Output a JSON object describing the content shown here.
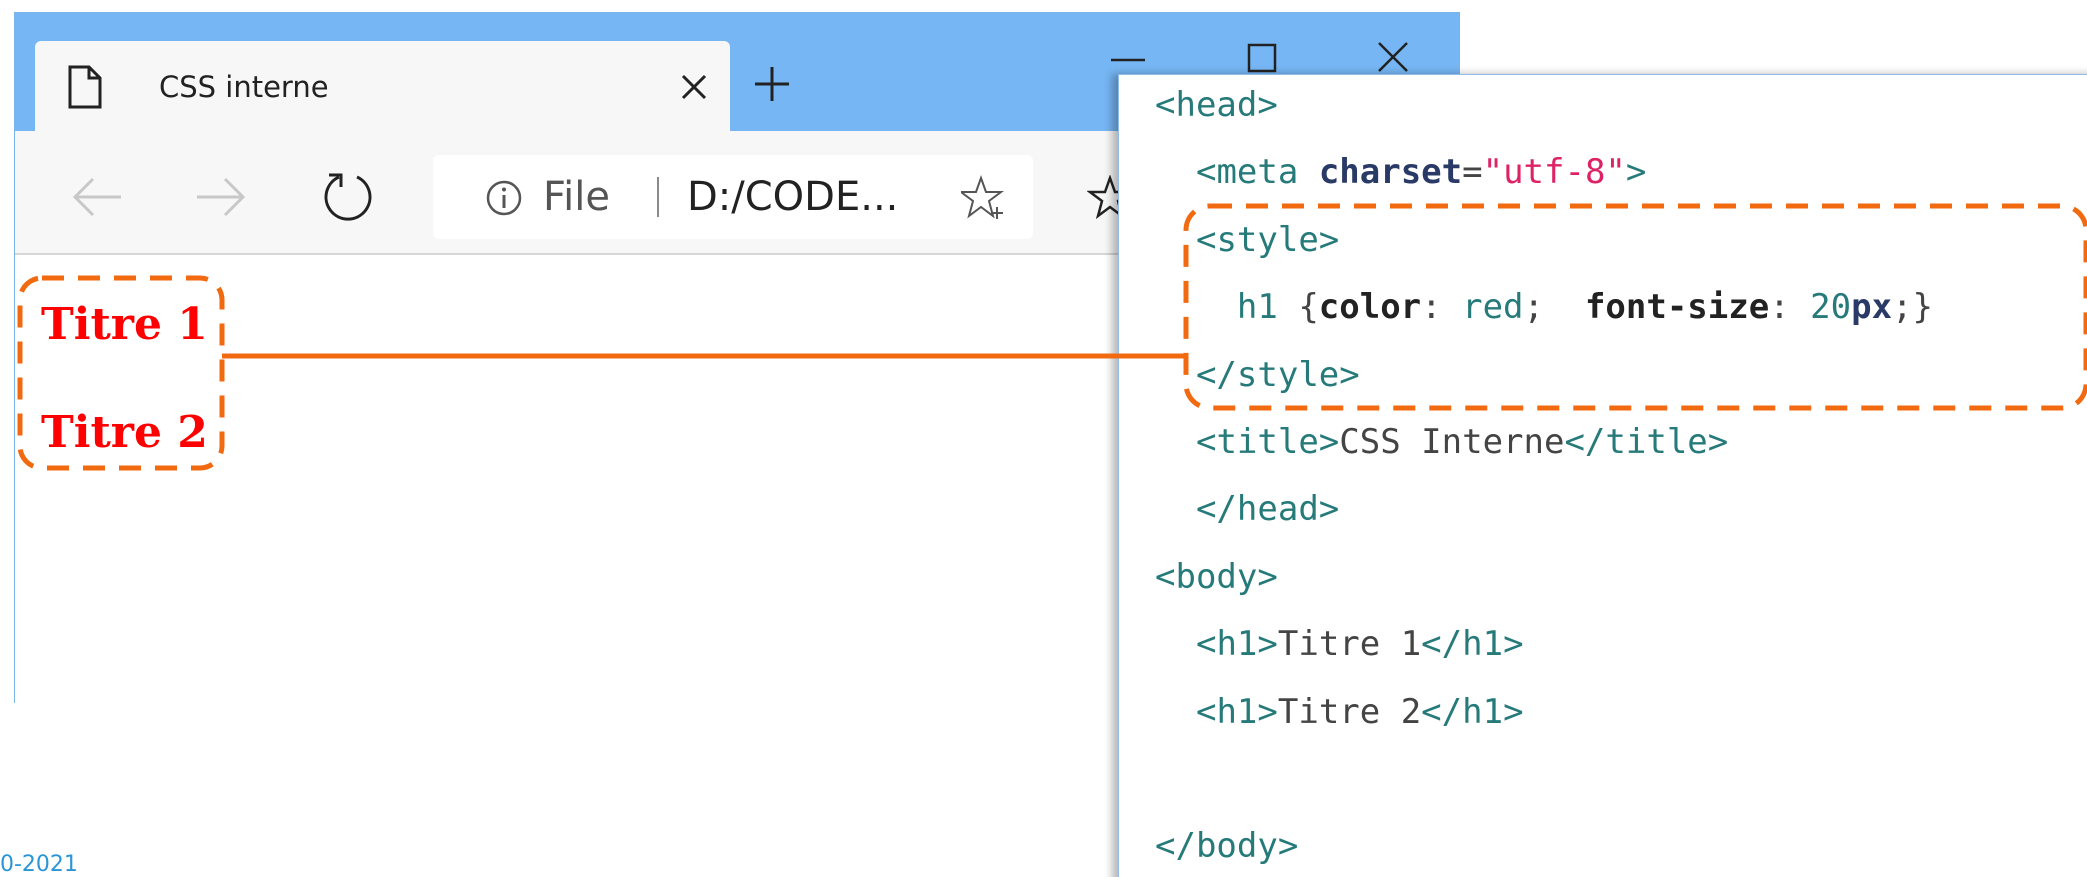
{
  "browser": {
    "tab": {
      "title": "CSS interne",
      "icon": "page-icon",
      "close_icon": "close-icon"
    },
    "new_tab_icon": "plus-icon",
    "window_controls": [
      "minimize-icon",
      "maximize-icon",
      "close-icon"
    ],
    "toolbar": {
      "back_icon": "arrow-left-icon",
      "forward_icon": "arrow-right-icon",
      "reload_icon": "reload-icon",
      "address": {
        "info_icon": "info-icon",
        "scheme_label": "File",
        "url": "D:/CODE...",
        "favorite_icon": "star-plus-icon"
      },
      "favorites_icon": "star-icon"
    },
    "page": {
      "headings": [
        "Titre 1",
        "Titre 2"
      ],
      "heading_color": "#ff0000"
    }
  },
  "code": {
    "lines": [
      [
        {
          "t": "<",
          "c": "tag"
        },
        {
          "t": "head",
          "c": "tag"
        },
        {
          "t": ">",
          "c": "tag"
        }
      ],
      [
        {
          "t": "  "
        },
        {
          "t": "<",
          "c": "tag"
        },
        {
          "t": "meta",
          "c": "tag"
        },
        {
          "t": " "
        },
        {
          "t": "charset",
          "c": "attr"
        },
        {
          "t": "="
        },
        {
          "t": "\"utf-8\"",
          "c": "str"
        },
        {
          "t": ">",
          "c": "tag"
        }
      ],
      [
        {
          "t": "  "
        },
        {
          "t": "<",
          "c": "tag"
        },
        {
          "t": "style",
          "c": "tag"
        },
        {
          "t": ">",
          "c": "tag"
        }
      ],
      [
        {
          "t": "    "
        },
        {
          "t": "h1",
          "c": "val"
        },
        {
          "t": " {"
        },
        {
          "t": "color",
          "c": "prop"
        },
        {
          "t": ": "
        },
        {
          "t": "red",
          "c": "val"
        },
        {
          "t": ";  "
        },
        {
          "t": "font-size",
          "c": "prop"
        },
        {
          "t": ": "
        },
        {
          "t": "20",
          "c": "val"
        },
        {
          "t": "px",
          "c": "attr"
        },
        {
          "t": ";}"
        }
      ],
      [
        {
          "t": "  "
        },
        {
          "t": "</",
          "c": "tag"
        },
        {
          "t": "style",
          "c": "tag"
        },
        {
          "t": ">",
          "c": "tag"
        }
      ],
      [
        {
          "t": "  "
        },
        {
          "t": "<",
          "c": "tag"
        },
        {
          "t": "title",
          "c": "tag"
        },
        {
          "t": ">",
          "c": "tag"
        },
        {
          "t": "CSS Interne"
        },
        {
          "t": "</",
          "c": "tag"
        },
        {
          "t": "title",
          "c": "tag"
        },
        {
          "t": ">",
          "c": "tag"
        }
      ],
      [
        {
          "t": "  "
        },
        {
          "t": "</",
          "c": "tag"
        },
        {
          "t": "head",
          "c": "tag"
        },
        {
          "t": ">",
          "c": "tag"
        }
      ],
      [
        {
          "t": "<",
          "c": "tag"
        },
        {
          "t": "body",
          "c": "tag"
        },
        {
          "t": ">",
          "c": "tag"
        }
      ],
      [
        {
          "t": "  "
        },
        {
          "t": "<",
          "c": "tag"
        },
        {
          "t": "h1",
          "c": "tag"
        },
        {
          "t": ">",
          "c": "tag"
        },
        {
          "t": "Titre 1"
        },
        {
          "t": "</",
          "c": "tag"
        },
        {
          "t": "h1",
          "c": "tag"
        },
        {
          "t": ">",
          "c": "tag"
        }
      ],
      [
        {
          "t": "  "
        },
        {
          "t": "<",
          "c": "tag"
        },
        {
          "t": "h1",
          "c": "tag"
        },
        {
          "t": ">",
          "c": "tag"
        },
        {
          "t": "Titre 2"
        },
        {
          "t": "</",
          "c": "tag"
        },
        {
          "t": "h1",
          "c": "tag"
        },
        {
          "t": ">",
          "c": "tag"
        }
      ],
      [],
      [
        {
          "t": "</",
          "c": "tag"
        },
        {
          "t": "body",
          "c": "tag"
        },
        {
          "t": ">",
          "c": "tag"
        }
      ]
    ]
  },
  "annotation": {
    "color": "#f26a10"
  },
  "footer": {
    "date_fragment": "0-2021"
  },
  "colors": {
    "titlebar": "#76b6f4",
    "toolbar": "#f7f7f7",
    "link_blue": "#2b95d6"
  }
}
